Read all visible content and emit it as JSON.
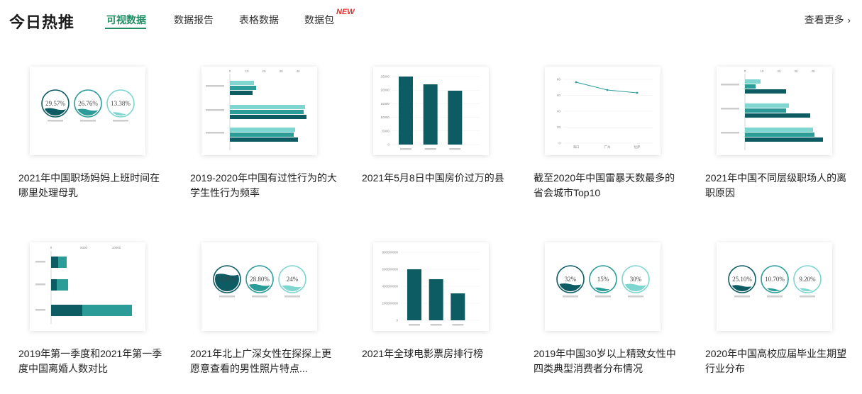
{
  "header": {
    "logo": "今日热推",
    "tabs": [
      {
        "label": "可视数据",
        "active": true
      },
      {
        "label": "数据报告",
        "active": false
      },
      {
        "label": "表格数据",
        "active": false
      },
      {
        "label": "数据包",
        "active": false
      }
    ],
    "new_badge": "NEW",
    "more_label": "查看更多",
    "accent_color": "#1f8f63",
    "badge_color": "#e0322b"
  },
  "cards": [
    {
      "title": "2021年中国职场妈妈上班时间在哪里处理母乳",
      "thumb": "bubbles",
      "icon": "bubble-gauge-chart",
      "bubbles": [
        {
          "pct": "29.57%",
          "level": 0.3
        },
        {
          "pct": "26.76%",
          "level": 0.27
        },
        {
          "pct": "13.38%",
          "level": 0.13
        }
      ]
    },
    {
      "title": "2019-2020年中国有过性行为的大学生性行为频率",
      "thumb": "hbar",
      "icon": "horizontal-bar-chart"
    },
    {
      "title": "2021年5月8日中国房价过万的县",
      "thumb": "vbar",
      "icon": "bar-chart",
      "y_ticks": [
        "25000",
        "20000",
        "15000",
        "10000",
        "5000",
        "0"
      ]
    },
    {
      "title": "截至2020年中国雷暴天数最多的省会城市Top10",
      "thumb": "line",
      "icon": "line-chart",
      "y_ticks": [
        "80",
        "60",
        "40",
        "20",
        "0"
      ],
      "x_ticks": [
        "海口",
        "广州",
        "拉萨"
      ]
    },
    {
      "title": "2021年中国不同层级职场人的离职原因",
      "thumb": "hbar2",
      "icon": "horizontal-bar-chart"
    },
    {
      "title": "2019年第一季度和2021年第一季度中国离婚人数对比",
      "thumb": "hbar3",
      "icon": "stacked-bar-chart",
      "x_ticks": [
        "0",
        "5000",
        "10000"
      ]
    },
    {
      "title": "2021年北上广深女性在探探上更愿意查看的男性照片特点...",
      "thumb": "bubbles",
      "icon": "bubble-gauge-chart",
      "bubbles": [
        {
          "pct": "71.70%",
          "level": 0.72
        },
        {
          "pct": "28.80%",
          "level": 0.29
        },
        {
          "pct": "24%",
          "level": 0.24
        }
      ]
    },
    {
      "title": "2021年全球电影票房排行榜",
      "thumb": "vbar2",
      "icon": "bar-chart",
      "y_ticks": [
        "800000000",
        "600000000",
        "400000000",
        "200000000",
        "0"
      ]
    },
    {
      "title": "2019年中国30岁以上精致女性中四类典型消费者分布情况",
      "thumb": "bubbles",
      "icon": "bubble-gauge-chart",
      "bubbles": [
        {
          "pct": "32%",
          "level": 0.32
        },
        {
          "pct": "15%",
          "level": 0.15
        },
        {
          "pct": "30%",
          "level": 0.3
        }
      ]
    },
    {
      "title": "2020年中国高校应届毕业生期望行业分布",
      "thumb": "bubbles",
      "icon": "bubble-gauge-chart",
      "bubbles": [
        {
          "pct": "25.10%",
          "level": 0.25
        },
        {
          "pct": "10.70%",
          "level": 0.11
        },
        {
          "pct": "9.20%",
          "level": 0.09
        }
      ]
    }
  ]
}
